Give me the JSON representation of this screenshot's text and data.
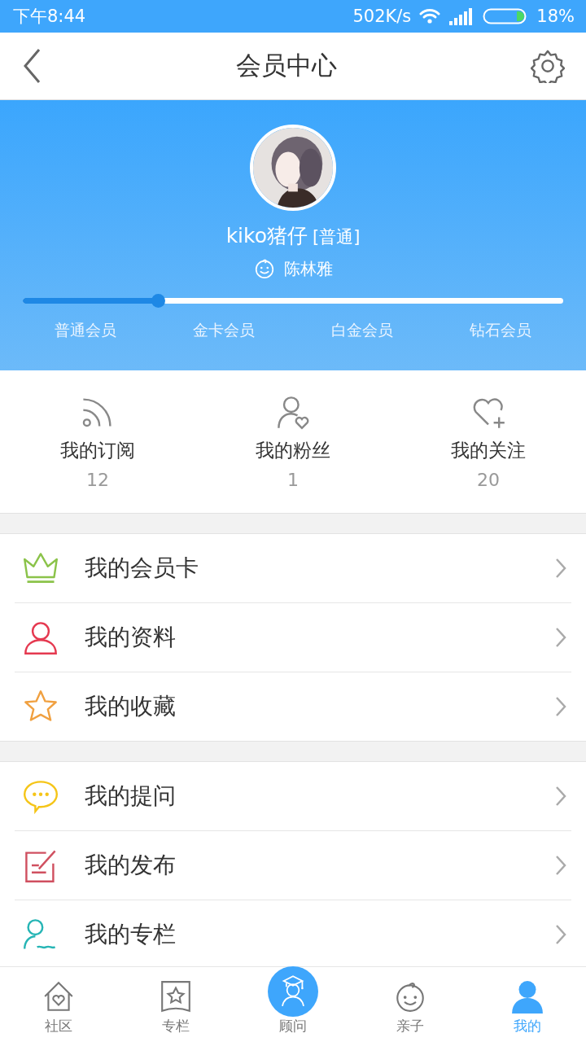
{
  "status_bar": {
    "time": "下午8:44",
    "speed": "502K/s",
    "battery": "18%"
  },
  "header": {
    "title": "会员中心"
  },
  "profile": {
    "avatar": {
      "kind": "picture"
    },
    "name": "kiko猪仔",
    "tier": "[普通]",
    "child": "陈林雅",
    "progress": {
      "level": 0.25
    },
    "tiers": [
      "普通会员",
      "金卡会员",
      "白金会员",
      "钻石会员"
    ]
  },
  "stats": [
    {
      "kind": "rss",
      "label": "我的订阅",
      "count": "12"
    },
    {
      "kind": "fans",
      "label": "我的粉丝",
      "count": "1"
    },
    {
      "kind": "follow",
      "label": "我的关注",
      "count": "20"
    }
  ],
  "menu_groups": [
    [
      {
        "kind": "crown",
        "label": "我的会员卡"
      },
      {
        "kind": "person",
        "label": "我的资料"
      },
      {
        "kind": "star",
        "label": "我的收藏"
      }
    ],
    [
      {
        "kind": "chat",
        "label": "我的提问"
      },
      {
        "kind": "edit",
        "label": "我的发布"
      },
      {
        "kind": "column",
        "label": "我的专栏"
      }
    ]
  ],
  "bottom_nav": [
    {
      "kind": "home",
      "label": "社区",
      "selected": false
    },
    {
      "kind": "book",
      "label": "专栏",
      "selected": false
    },
    {
      "kind": "advisor",
      "label": "顾问",
      "selected": false
    },
    {
      "kind": "baby",
      "label": "亲子",
      "selected": false
    },
    {
      "kind": "me",
      "label": "我的",
      "selected": true
    }
  ]
}
